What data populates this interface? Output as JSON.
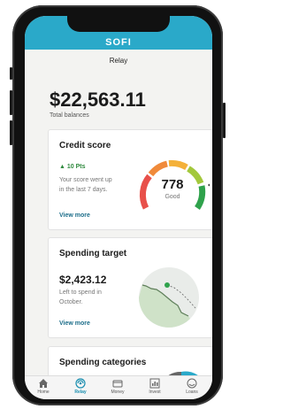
{
  "app": {
    "brand": "SOFI",
    "title": "Relay"
  },
  "total": {
    "amount": "$22,563.11",
    "label": "Total balances"
  },
  "credit": {
    "title": "Credit score",
    "change": "10 Pts",
    "description_line1": "Your score went up",
    "description_line2": "in the last 7 days.",
    "score": "778",
    "rating": "Good",
    "link": "View more"
  },
  "spending_target": {
    "title": "Spending target",
    "amount": "$2,423.12",
    "description_line1": "Left to spend in",
    "description_line2": "October.",
    "link": "View more"
  },
  "spending_categories": {
    "title": "Spending categories"
  },
  "tabs": [
    {
      "label": "Home",
      "icon": "home-icon",
      "active": false
    },
    {
      "label": "Relay",
      "icon": "relay-icon",
      "active": true
    },
    {
      "label": "Money",
      "icon": "money-icon",
      "active": false
    },
    {
      "label": "Invest",
      "icon": "invest-icon",
      "active": false
    },
    {
      "label": "Loans",
      "icon": "loans-icon",
      "active": false
    }
  ],
  "colors": {
    "header": "#2aa9c9",
    "accent": "#1a8fb0",
    "positive": "#2f8a3e"
  }
}
